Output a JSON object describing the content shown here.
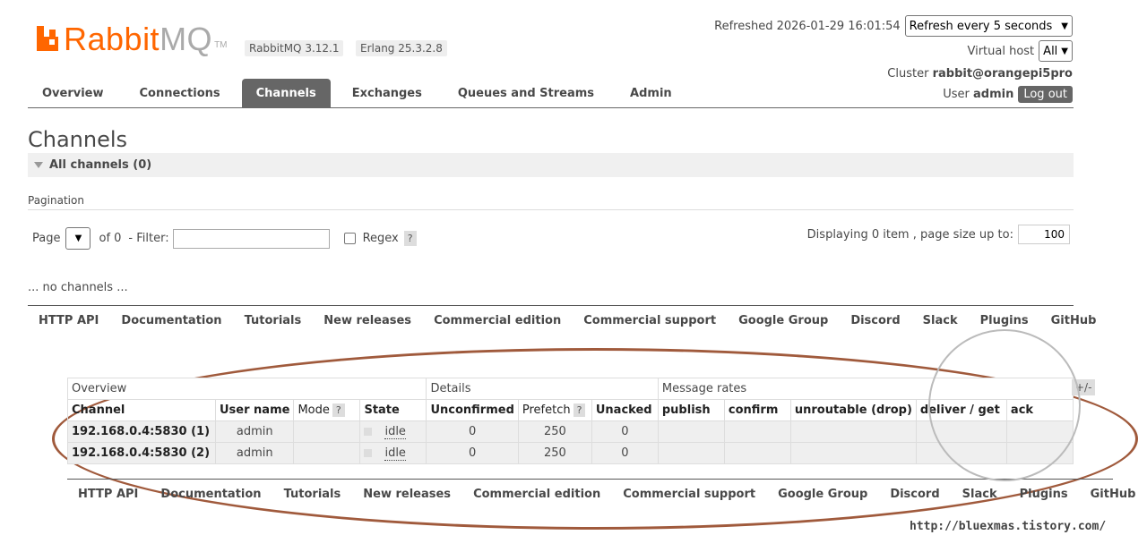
{
  "header": {
    "logo_rabbit": "Rabbit",
    "logo_mq": "MQ",
    "logo_tm": "TM",
    "version_rabbitmq": "RabbitMQ 3.12.1",
    "version_erlang": "Erlang 25.3.2.8",
    "refreshed_label": "Refreshed 2026-01-29 16:01:54",
    "refresh_select": "Refresh every 5 seconds",
    "vhost_label": "Virtual host",
    "vhost_select": "All",
    "cluster_label": "Cluster",
    "cluster_name": "rabbit@orangepi5pro",
    "user_label": "User",
    "user_name": "admin",
    "logout_label": "Log out"
  },
  "nav": {
    "tabs": [
      "Overview",
      "Connections",
      "Channels",
      "Exchanges",
      "Queues and Streams",
      "Admin"
    ],
    "active": "Channels"
  },
  "page": {
    "title": "Channels",
    "section_title": "All channels (0)",
    "pagination_label": "Pagination",
    "page_label": "Page",
    "of_label": "of 0",
    "filter_label": "- Filter:",
    "regex_label": "Regex",
    "help_mark": "?",
    "displaying_label": "Displaying 0 item , page size up to:",
    "page_size": "100",
    "no_channels": "... no channels ..."
  },
  "footer_links": [
    "HTTP API",
    "Documentation",
    "Tutorials",
    "New releases",
    "Commercial edition",
    "Commercial support",
    "Google Group",
    "Discord",
    "Slack",
    "Plugins",
    "GitHub"
  ],
  "channel_table": {
    "groups": [
      "Overview",
      "Details",
      "Message rates"
    ],
    "columns": [
      "Channel",
      "User name",
      "Mode",
      "State",
      "Unconfirmed",
      "Prefetch",
      "Unacked",
      "publish",
      "confirm",
      "unroutable (drop)",
      "deliver / get",
      "ack"
    ],
    "plusminus": "+/-",
    "rows": [
      {
        "channel": "192.168.0.4:5830 (1)",
        "user": "admin",
        "mode": "",
        "state": "idle",
        "unconfirmed": "0",
        "prefetch": "250",
        "unacked": "0"
      },
      {
        "channel": "192.168.0.4:5830 (2)",
        "user": "admin",
        "mode": "",
        "state": "idle",
        "unconfirmed": "0",
        "prefetch": "250",
        "unacked": "0"
      }
    ]
  },
  "watermark": {
    "url": "http://bluexmas.tistory.com/"
  },
  "colors": {
    "brand_orange": "#ff6600",
    "tab_active_bg": "#666666",
    "annotation": "#a05a3c"
  }
}
